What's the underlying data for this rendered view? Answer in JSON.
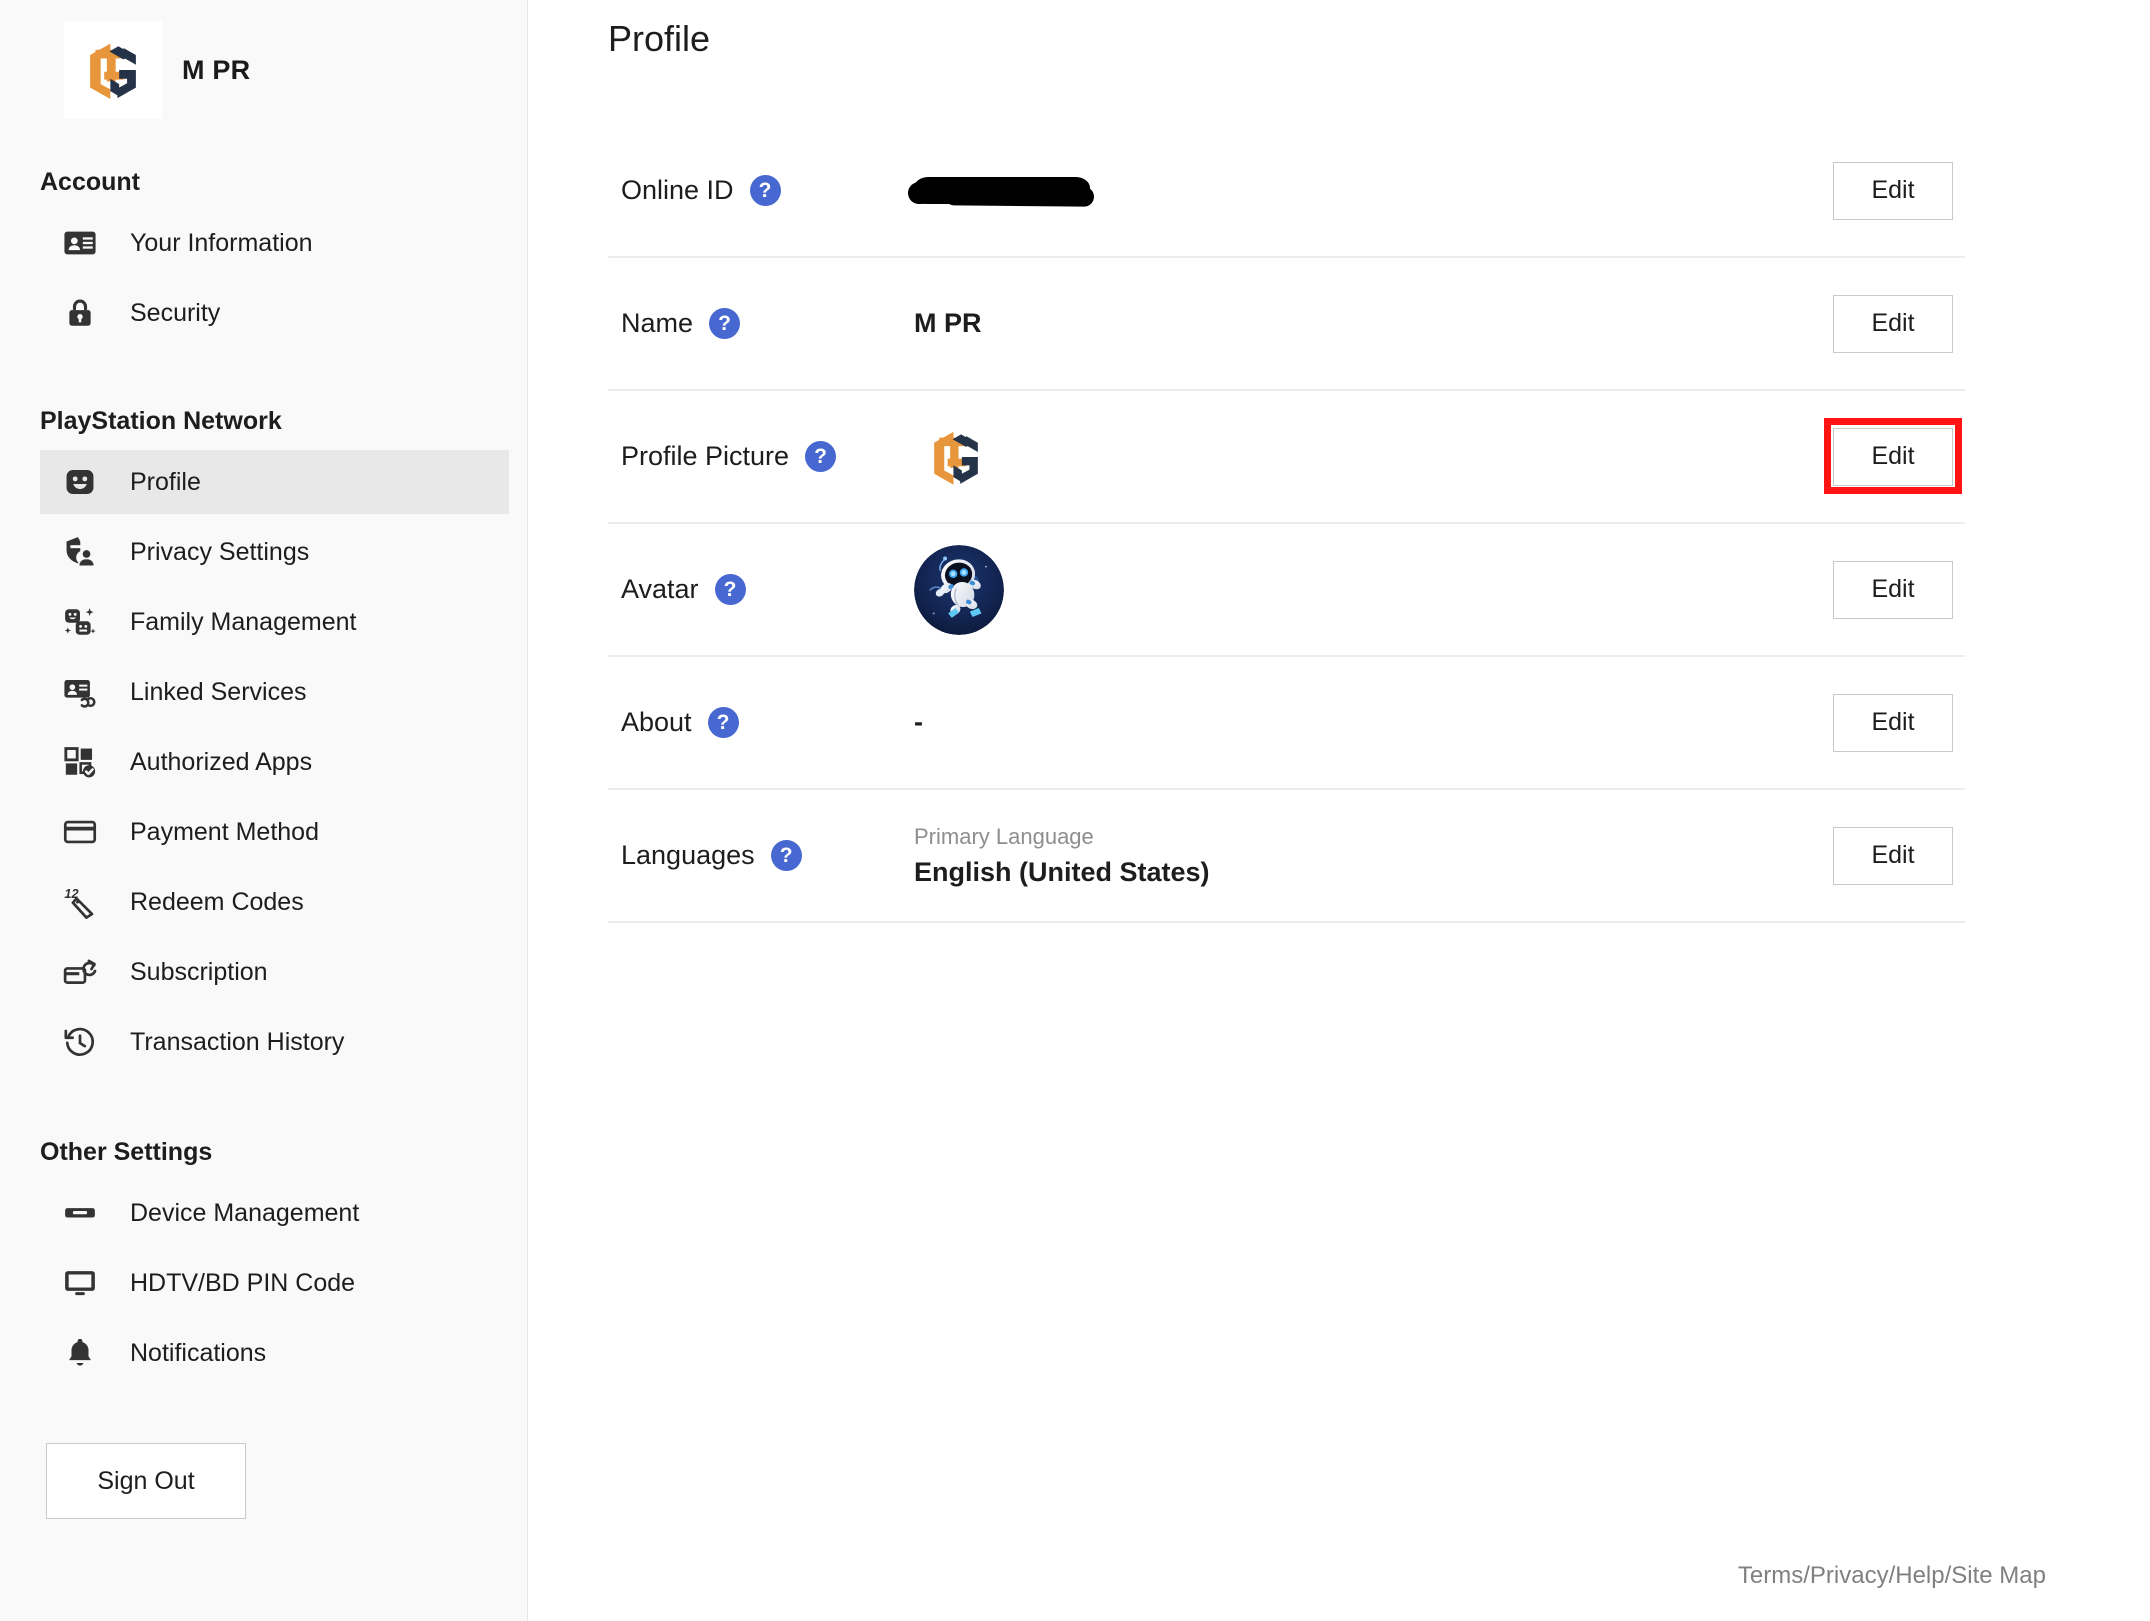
{
  "brand": {
    "name": "M PR",
    "logo_icon": "hexagon-monogram-logo",
    "logo_colors": {
      "orange": "#E8963C",
      "navy": "#253349"
    }
  },
  "sidebar": {
    "groups": [
      {
        "title": "Account",
        "items": [
          {
            "label": "Your Information",
            "icon": "id-card-icon",
            "active": false
          },
          {
            "label": "Security",
            "icon": "lock-icon",
            "active": false
          }
        ]
      },
      {
        "title": "PlayStation Network",
        "items": [
          {
            "label": "Profile",
            "icon": "smiley-face-icon",
            "active": true
          },
          {
            "label": "Privacy Settings",
            "icon": "shield-person-icon",
            "active": false
          },
          {
            "label": "Family Management",
            "icon": "family-faces-icon",
            "active": false
          },
          {
            "label": "Linked Services",
            "icon": "id-card-link-icon",
            "active": false
          },
          {
            "label": "Authorized Apps",
            "icon": "apps-check-icon",
            "active": false
          },
          {
            "label": "Payment Method",
            "icon": "credit-card-icon",
            "active": false
          },
          {
            "label": "Redeem Codes",
            "icon": "price-tag-12-icon",
            "active": false
          },
          {
            "label": "Subscription",
            "icon": "card-refresh-icon",
            "active": false
          },
          {
            "label": "Transaction History",
            "icon": "clock-history-icon",
            "active": false
          }
        ]
      },
      {
        "title": "Other Settings",
        "items": [
          {
            "label": "Device Management",
            "icon": "device-icon",
            "active": false
          },
          {
            "label": "HDTV/BD PIN Code",
            "icon": "monitor-icon",
            "active": false
          },
          {
            "label": "Notifications",
            "icon": "bell-icon",
            "active": false
          }
        ]
      }
    ],
    "sign_out_label": "Sign Out"
  },
  "main": {
    "title": "Profile",
    "help_icon_glyph": "?",
    "help_icon_color": "#4668D0",
    "rows": [
      {
        "label": "Online ID",
        "value_type": "redacted",
        "value": "",
        "edit_label": "Edit",
        "highlighted": false
      },
      {
        "label": "Name",
        "value_type": "text",
        "value": "M PR",
        "edit_label": "Edit",
        "highlighted": false
      },
      {
        "label": "Profile Picture",
        "value_type": "logo-image",
        "value": "hexagon-monogram-logo",
        "edit_label": "Edit",
        "highlighted": true
      },
      {
        "label": "Avatar",
        "value_type": "avatar-image",
        "value": "astro-bot-avatar",
        "edit_label": "Edit",
        "highlighted": false
      },
      {
        "label": "About",
        "value_type": "text",
        "value": "-",
        "edit_label": "Edit",
        "highlighted": false
      },
      {
        "label": "Languages",
        "value_type": "language",
        "caption": "Primary Language",
        "value": "English (United States)",
        "edit_label": "Edit",
        "highlighted": false
      }
    ],
    "highlight_color": "#FF1414"
  },
  "footer": {
    "text": "Terms/Privacy/Help/Site Map"
  }
}
